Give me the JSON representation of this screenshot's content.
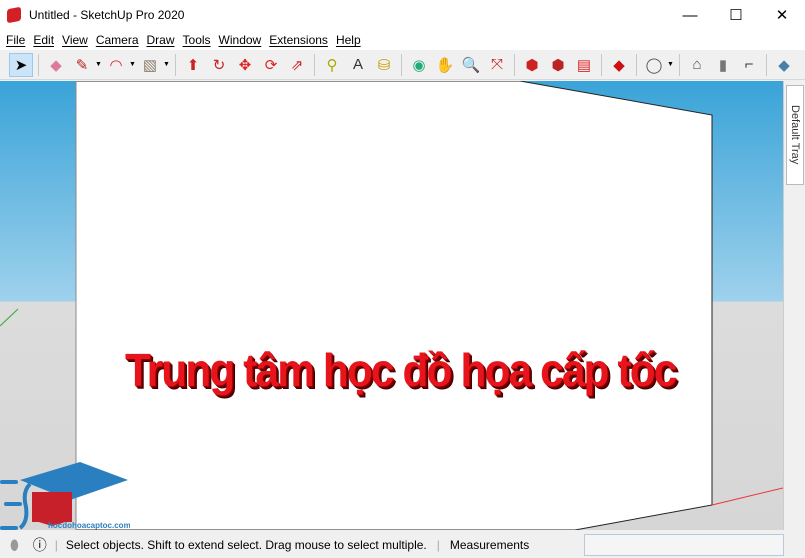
{
  "window": {
    "title": "Untitled - SketchUp Pro 2020",
    "minimize": "—",
    "maximize": "☐",
    "close": "✕"
  },
  "menu": [
    "File",
    "Edit",
    "View",
    "Camera",
    "Draw",
    "Tools",
    "Window",
    "Extensions",
    "Help"
  ],
  "toolbar": [
    {
      "name": "select-icon",
      "glyph": "➤",
      "color": "#000"
    },
    {
      "name": "eraser-icon",
      "glyph": "◆",
      "color": "#e07a9a"
    },
    {
      "name": "pencil-icon",
      "glyph": "✎",
      "color": "#b22"
    },
    {
      "name": "arc-icon",
      "glyph": "◠",
      "color": "#d22"
    },
    {
      "name": "rectangle-icon",
      "glyph": "▧",
      "color": "#8a7c6a"
    },
    {
      "name": "push-pull-icon",
      "glyph": "⬆",
      "color": "#c22"
    },
    {
      "name": "follow-me-icon",
      "glyph": "↻",
      "color": "#c22"
    },
    {
      "name": "move-icon",
      "glyph": "✥",
      "color": "#d22"
    },
    {
      "name": "rotate-icon",
      "glyph": "⟳",
      "color": "#d22"
    },
    {
      "name": "scale-icon",
      "glyph": "⇗",
      "color": "#c22"
    },
    {
      "name": "tape-measure-icon",
      "glyph": "⚲",
      "color": "#aa0"
    },
    {
      "name": "text-icon",
      "glyph": "A",
      "color": "#333"
    },
    {
      "name": "paint-bucket-icon",
      "glyph": "⛁",
      "color": "#c90"
    },
    {
      "name": "orbit-icon",
      "glyph": "◉",
      "color": "#2a7"
    },
    {
      "name": "pan-icon",
      "glyph": "✋",
      "color": "#dbb"
    },
    {
      "name": "zoom-icon",
      "glyph": "🔍",
      "color": "#357"
    },
    {
      "name": "zoom-extents-icon",
      "glyph": "⤧",
      "color": "#c22"
    },
    {
      "name": "warehouse-icon",
      "glyph": "⬢",
      "color": "#c22"
    },
    {
      "name": "extension-warehouse-icon",
      "glyph": "⬢",
      "color": "#b22"
    },
    {
      "name": "layout-icon",
      "glyph": "▤",
      "color": "#d22"
    },
    {
      "name": "ruby-icon",
      "glyph": "◆",
      "color": "#c11"
    },
    {
      "name": "account-icon",
      "glyph": "◯",
      "color": "#555"
    },
    {
      "name": "house-icon",
      "glyph": "⌂",
      "color": "#555"
    },
    {
      "name": "door-icon",
      "glyph": "▮",
      "color": "#777"
    },
    {
      "name": "wall-icon",
      "glyph": "⌐",
      "color": "#333"
    },
    {
      "name": "box-icon",
      "glyph": "◆",
      "color": "#4a7fa8"
    }
  ],
  "tray": {
    "label": "Default Tray"
  },
  "canvas": {
    "text": "Trung tâm học đồ họa cấp tốc",
    "text_color": "#e8141b"
  },
  "logo": {
    "text": "hocdohoacaptoc.com"
  },
  "status": {
    "hint": "Select objects. Shift to extend select. Drag mouse to select multiple.",
    "measurements_label": "Measurements",
    "measurements_value": ""
  }
}
